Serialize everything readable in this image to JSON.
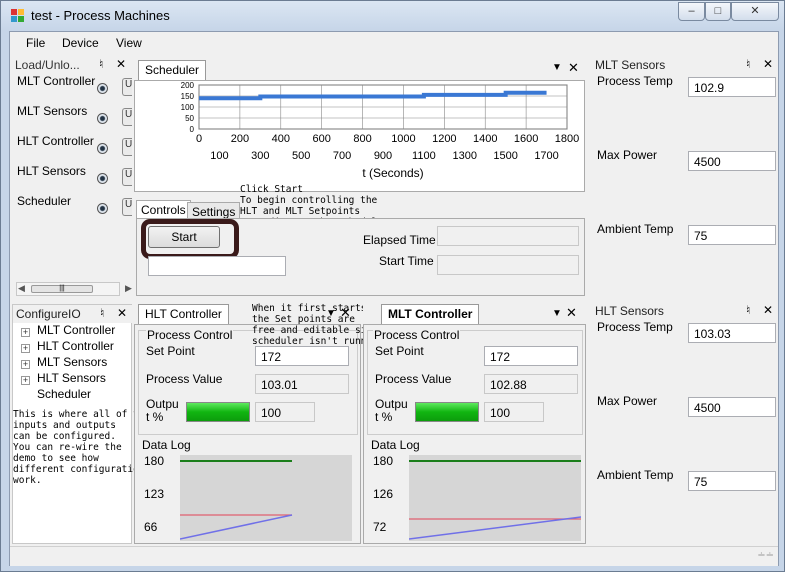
{
  "window": {
    "title": "test - Process Machines"
  },
  "menu": [
    "File",
    "Device",
    "View"
  ],
  "left_top": {
    "caption": "Load/Unlo...",
    "items": [
      "MLT Controller",
      "MLT Sensors",
      "HLT Controller",
      "HLT Sensors",
      "Scheduler"
    ],
    "button_stub": "U"
  },
  "configure": {
    "caption": "ConfigureIO",
    "tree": [
      "MLT Controller",
      "HLT Controller",
      "MLT Sensors",
      "HLT Sensors",
      "Scheduler"
    ],
    "note": "This is where all of the\ninputs and outputs\ncan be configured.\nYou can re-wire the\ndemo to see how\ndifferent configurations\nwork."
  },
  "scheduler": {
    "tab": "Scheduler",
    "tabs": [
      "Controls",
      "Settings"
    ],
    "start": "Start",
    "elapsed_label": "Elapsed Time",
    "start_time_label": "Start Time",
    "note": "Click Start\nTo begin controlling the\nHLT and MLT Setpoints\nAccording to the Schedule"
  },
  "chart_data": {
    "type": "line",
    "xlabel": "t (Seconds)",
    "x_ticks_top": [
      "0",
      "200",
      "400",
      "600",
      "800",
      "1000",
      "1200",
      "1400",
      "1600",
      "1800"
    ],
    "x_ticks_bottom": [
      "100",
      "300",
      "500",
      "700",
      "900",
      "1100",
      "1300",
      "1500",
      "1700"
    ],
    "y_ticks": [
      "200",
      "150",
      "100",
      "50",
      "0"
    ],
    "xlim": [
      0,
      1800
    ],
    "ylim": [
      0,
      200
    ],
    "series": [
      {
        "color": "#3a78d4",
        "points": [
          [
            0,
            140
          ],
          [
            300,
            140
          ],
          [
            300,
            148
          ],
          [
            1100,
            148
          ],
          [
            1100,
            155
          ],
          [
            1500,
            155
          ],
          [
            1500,
            165
          ],
          [
            1700,
            165
          ]
        ]
      }
    ]
  },
  "hlt": {
    "tab": "HLT Controller",
    "process_control": "Process Control",
    "set_point_label": "Set Point",
    "set_point": "172",
    "process_value_label": "Process Value",
    "process_value": "103.01",
    "output_label": "Outpu\nt %",
    "output": "100",
    "output_fill": 1.0,
    "data_log": "Data Log",
    "y_ticks": [
      "180",
      "123",
      "66"
    ],
    "note": "When it first starts\nthe Set points are\nfree and editable since the\nscheduler isn't running"
  },
  "mlt": {
    "tab": "MLT Controller",
    "process_control": "Process Control",
    "set_point_label": "Set Point",
    "set_point": "172",
    "process_value_label": "Process Value",
    "process_value": "102.88",
    "output_label": "Outpu\nt %",
    "output": "100",
    "output_fill": 1.0,
    "data_log": "Data Log",
    "y_ticks": [
      "180",
      "126",
      "72"
    ]
  },
  "mlt_sensors": {
    "caption": "MLT Sensors",
    "process_temp_label": "Process Temp",
    "process_temp": "102.9",
    "max_power_label": "Max Power",
    "max_power": "4500",
    "ambient_label": "Ambient Temp",
    "ambient": "75"
  },
  "hlt_sensors": {
    "caption": "HLT Sensors",
    "process_temp_label": "Process Temp",
    "process_temp": "103.03",
    "max_power_label": "Max Power",
    "max_power": "4500",
    "ambient_label": "Ambient Temp",
    "ambient": "75"
  },
  "colors": {
    "accent_outline": "#3a1a1a",
    "series_blue": "#3a78d4",
    "setpoint_green": "#1b7e1b",
    "pv_red": "#e06070",
    "out_blue": "#7070e8"
  }
}
